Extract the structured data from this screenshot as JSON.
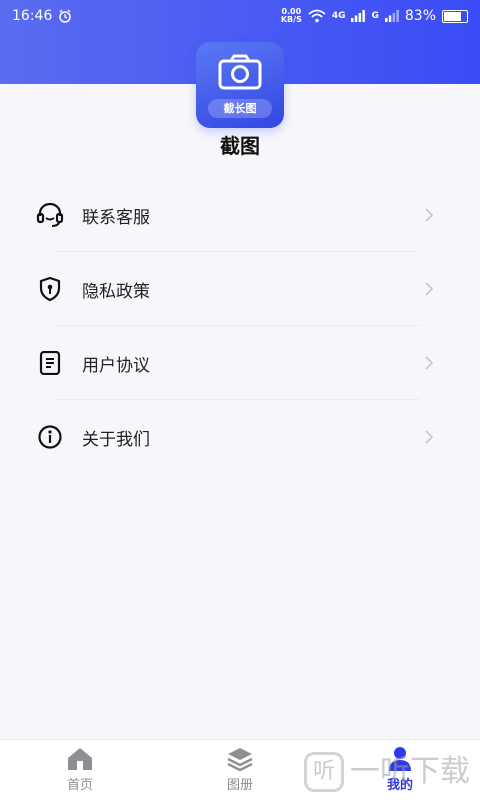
{
  "status_bar": {
    "time": "16:46",
    "net_speed_value": "0.00",
    "net_speed_unit": "KB/S",
    "signal1_label": "4G",
    "signal2_label": "G",
    "battery_percent": "83%",
    "battery_level": 0.83
  },
  "app": {
    "icon_badge": "截长图",
    "title": "截图"
  },
  "menu": {
    "items": [
      {
        "label": "联系客服",
        "icon": "headset-icon"
      },
      {
        "label": "隐私政策",
        "icon": "shield-icon"
      },
      {
        "label": "用户协议",
        "icon": "document-icon"
      },
      {
        "label": "关于我们",
        "icon": "info-icon"
      }
    ]
  },
  "tabbar": {
    "tabs": [
      {
        "label": "首页",
        "icon": "home-icon",
        "active": false
      },
      {
        "label": "图册",
        "icon": "layers-icon",
        "active": false
      },
      {
        "label": "我的",
        "icon": "person-icon",
        "active": true
      }
    ]
  },
  "watermark": {
    "glyph": "听",
    "text": "一听下载"
  },
  "colors": {
    "accent": "#2f3ae8",
    "header_start": "#5a6cf0",
    "header_end": "#3a4cf5",
    "text": "#222222",
    "inactive": "#8e8e93"
  }
}
